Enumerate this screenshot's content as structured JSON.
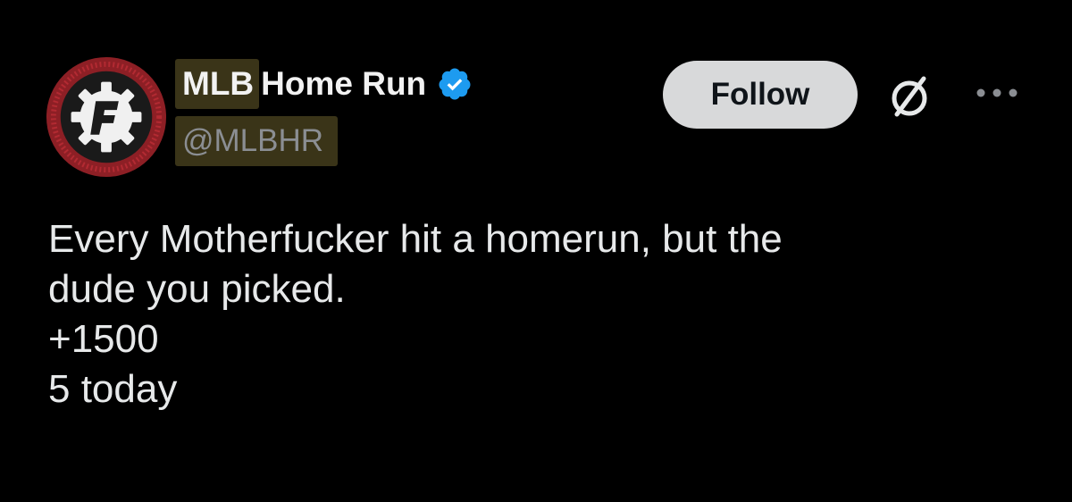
{
  "tweet": {
    "author": {
      "name_highlighted": "MLB",
      "name_rest": "Home Run",
      "handle": "@MLBHR",
      "verified": true,
      "avatar_icon": "gear-logo-avatar",
      "avatar_colors": {
        "ring": "#8d1f25",
        "inner": "#1a1a1a",
        "logo": "#f0f0f0"
      }
    },
    "follow_label": "Follow",
    "grok_icon": "grok-icon",
    "more_icon": "more-options-icon",
    "text_lines": [
      "Every Motherfucker hit a homerun, but the",
      "dude you picked.",
      "+1500",
      "5 today"
    ]
  },
  "colors": {
    "background": "#000000",
    "text_primary": "#e7e9ea",
    "text_secondary": "#8b8e93",
    "highlight": "#3a3418",
    "follow_button_bg": "#d8d9da",
    "verified_badge": "#1d9bf0"
  }
}
